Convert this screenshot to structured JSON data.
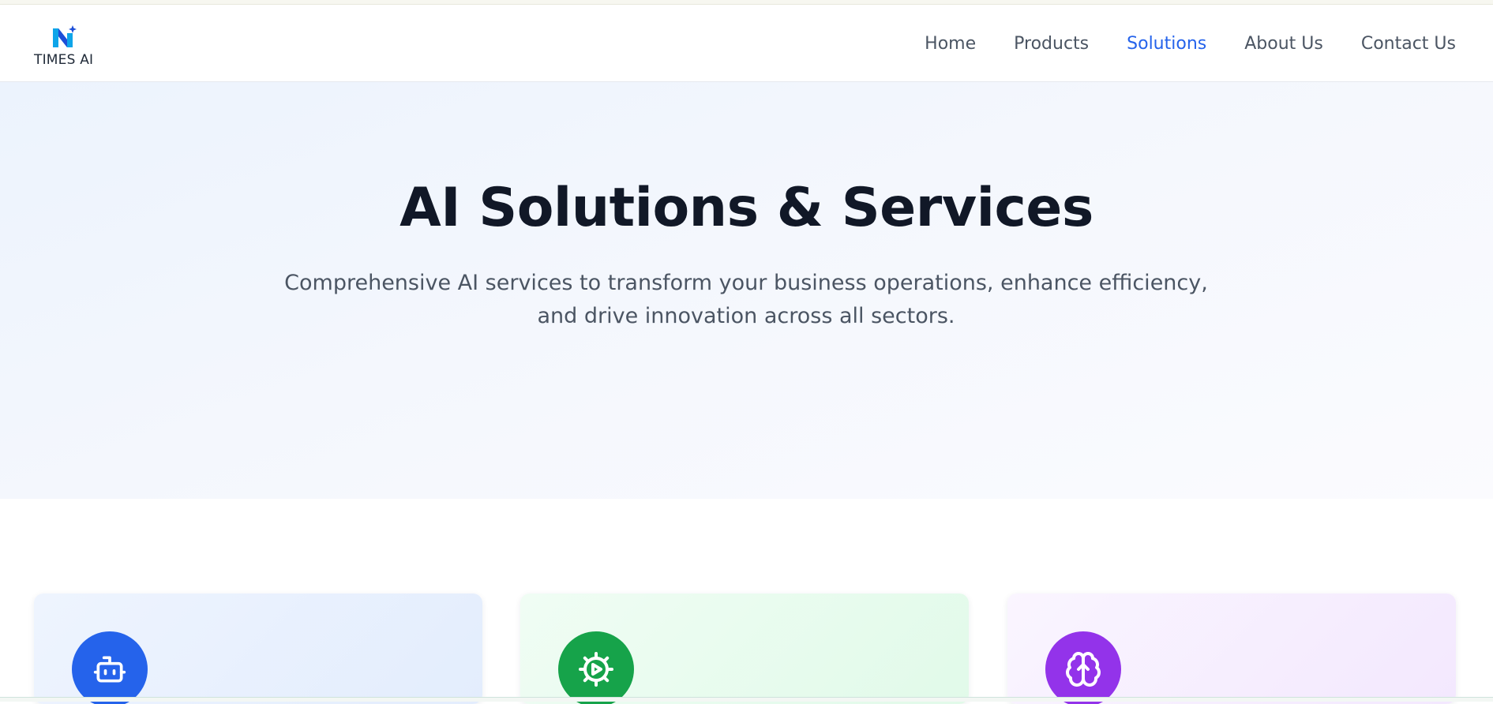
{
  "brand": {
    "name": "TIMES AI",
    "logo_icon": "n-spark-logo",
    "colors": {
      "logo_primary": "#0ea5e9",
      "logo_dark": "#1d4ed8"
    }
  },
  "nav": {
    "items": [
      {
        "label": "Home",
        "active": false
      },
      {
        "label": "Products",
        "active": false
      },
      {
        "label": "Solutions",
        "active": true
      },
      {
        "label": "About Us",
        "active": false
      },
      {
        "label": "Contact Us",
        "active": false
      }
    ],
    "active_color": "#2563eb"
  },
  "hero": {
    "title": "AI Solutions & Services",
    "subtitle": "Comprehensive AI services to transform your business operations, enhance efficiency, and drive innovation across all sectors."
  },
  "cards": [
    {
      "icon": "robot-icon",
      "color": "#2563eb"
    },
    {
      "icon": "gear-play-icon",
      "color": "#16a34a"
    },
    {
      "icon": "brain-icon",
      "color": "#9333ea"
    }
  ]
}
